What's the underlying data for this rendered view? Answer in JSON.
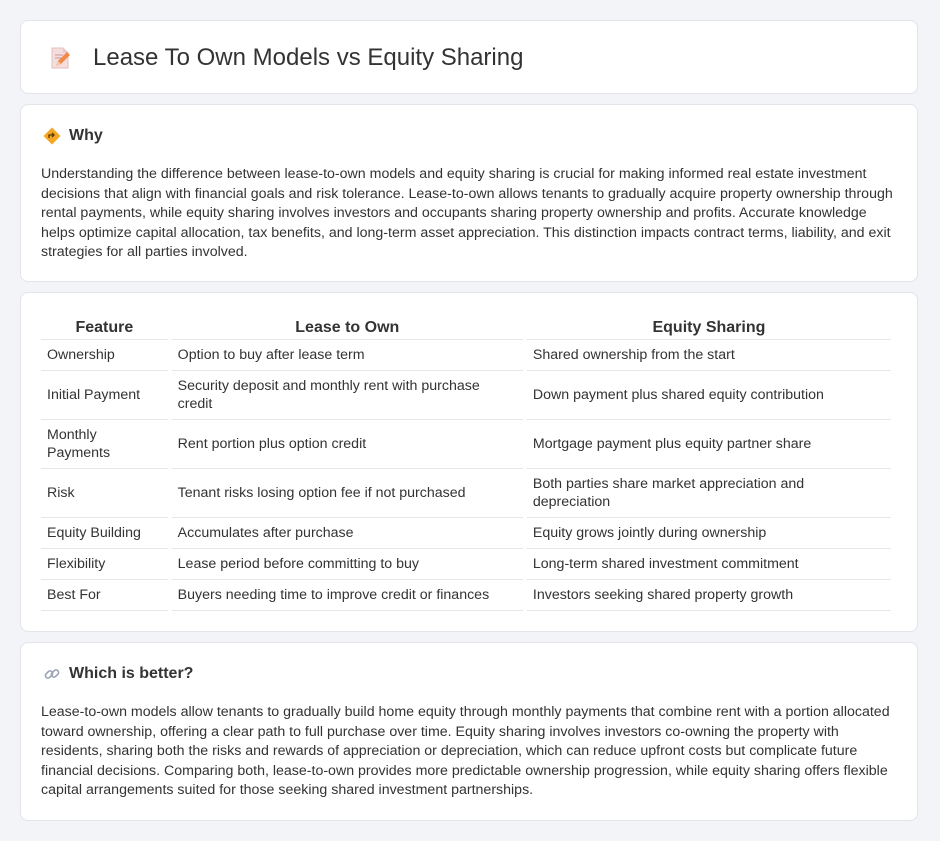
{
  "header": {
    "title": "Lease To Own Models vs Equity Sharing",
    "icon": "document-pencil-icon"
  },
  "why": {
    "icon": "road-sign-icon",
    "heading": "Why",
    "text": "Understanding the difference between lease-to-own models and equity sharing is crucial for making informed real estate investment decisions that align with financial goals and risk tolerance. Lease-to-own allows tenants to gradually acquire property ownership through rental payments, while equity sharing involves investors and occupants sharing property ownership and profits. Accurate knowledge helps optimize capital allocation, tax benefits, and long-term asset appreciation. This distinction impacts contract terms, liability, and exit strategies for all parties involved."
  },
  "comparison": {
    "headers": [
      "Feature",
      "Lease to Own",
      "Equity Sharing"
    ],
    "rows": [
      [
        "Ownership",
        "Option to buy after lease term",
        "Shared ownership from the start"
      ],
      [
        "Initial Payment",
        "Security deposit and monthly rent with purchase credit",
        "Down payment plus shared equity contribution"
      ],
      [
        "Monthly Payments",
        "Rent portion plus option credit",
        "Mortgage payment plus equity partner share"
      ],
      [
        "Risk",
        "Tenant risks losing option fee if not purchased",
        "Both parties share market appreciation and depreciation"
      ],
      [
        "Equity Building",
        "Accumulates after purchase",
        "Equity grows jointly during ownership"
      ],
      [
        "Flexibility",
        "Lease period before committing to buy",
        "Long-term shared investment commitment"
      ],
      [
        "Best For",
        "Buyers needing time to improve credit or finances",
        "Investors seeking shared property growth"
      ]
    ]
  },
  "better": {
    "icon": "link-icon",
    "heading": "Which is better?",
    "text": "Lease-to-own models allow tenants to gradually build home equity through monthly payments that combine rent with a portion allocated toward ownership, offering a clear path to full purchase over time. Equity sharing involves investors co-owning the property with residents, sharing both the risks and rewards of appreciation or depreciation, which can reduce upfront costs but complicate future financial decisions. Comparing both, lease-to-own provides more predictable ownership progression, while equity sharing offers flexible capital arrangements suited for those seeking shared investment partnerships."
  },
  "colors": {
    "background": "#f3f4f8",
    "card": "#ffffff",
    "border": "#e2e4ea",
    "text": "#333333"
  }
}
